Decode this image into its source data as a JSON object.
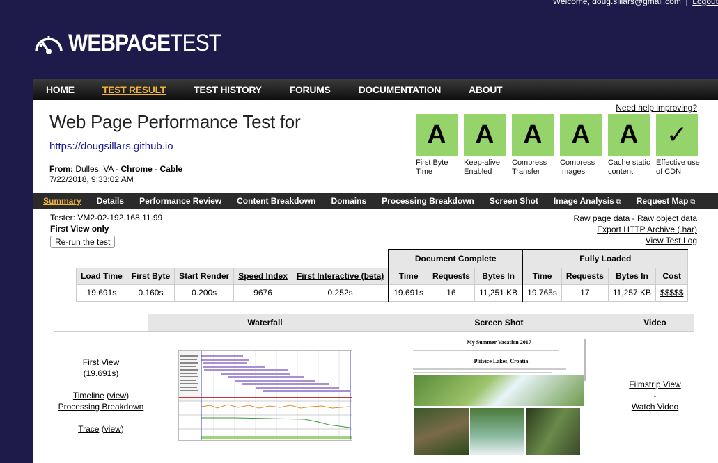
{
  "user": {
    "welcome": "Welcome, doug.sillars@gmail.com",
    "sep": "|",
    "logout": "Logout"
  },
  "logo": {
    "bold": "WEBPAGE",
    "thin": "TEST"
  },
  "nav": [
    "HOME",
    "TEST RESULT",
    "TEST HISTORY",
    "FORUMS",
    "DOCUMENTATION",
    "ABOUT"
  ],
  "header": {
    "help": "Need help improving?",
    "title": "Web Page Performance Test for",
    "url": "https://dougsillars.github.io",
    "from_label": "From:",
    "from_value": "Dulles, VA - ",
    "browser": "Chrome",
    "dash": " - ",
    "connection": "Cable",
    "date": "7/22/2018, 9:33:02 AM"
  },
  "grades": [
    {
      "grade": "A",
      "label": "First Byte Time"
    },
    {
      "grade": "A",
      "label": "Keep-alive Enabled"
    },
    {
      "grade": "A",
      "label": "Compress Transfer"
    },
    {
      "grade": "A",
      "label": "Compress Images"
    },
    {
      "grade": "A",
      "label": "Cache static content"
    },
    {
      "grade": "✓",
      "label": "Effective use of CDN"
    }
  ],
  "subnav": [
    "Summary",
    "Details",
    "Performance Review",
    "Content Breakdown",
    "Domains",
    "Processing Breakdown",
    "Screen Shot",
    "Image Analysis",
    "Request Map"
  ],
  "info": {
    "tester": "Tester: VM2-02-192.168.11.99",
    "first_view": "First View only",
    "rerun": "Re-run the test"
  },
  "links": [
    "Raw page data",
    "Raw object data",
    "Export HTTP Archive (.har)",
    "View Test Log"
  ],
  "summary": {
    "group_doc": "Document Complete",
    "group_full": "Fully Loaded",
    "headers": [
      "Load Time",
      "First Byte",
      "Start Render",
      "Speed Index",
      "First Interactive (beta)",
      "Time",
      "Requests",
      "Bytes In",
      "Time",
      "Requests",
      "Bytes In",
      "Cost"
    ],
    "values": [
      "19.691s",
      "0.160s",
      "0.200s",
      "9676",
      "0.252s",
      "19.691s",
      "16",
      "11,251 KB",
      "19.765s",
      "17",
      "11,257 KB",
      "$$$$$"
    ]
  },
  "media": {
    "headers": [
      "Waterfall",
      "Screen Shot",
      "Video"
    ],
    "view_label": "First View",
    "view_time": "(19.691s)",
    "timeline": "Timeline",
    "timeline_view": "view",
    "processing": "Processing Breakdown",
    "trace": "Trace",
    "trace_view": "view",
    "filmstrip": "Filmstrip View",
    "dash": "-",
    "watch": "Watch Video"
  },
  "screenshot": {
    "title": "My Summer Vacation 2017",
    "subtitle": "Plitvice Lakes, Croatia"
  }
}
